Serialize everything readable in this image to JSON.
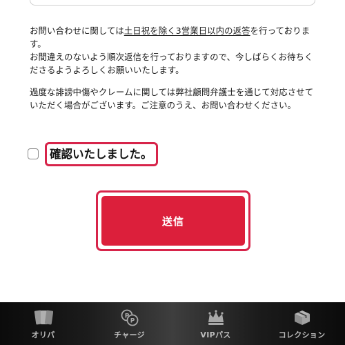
{
  "notice": {
    "para1_pre": "お問い合わせに関しては",
    "para1_underlined": "土日祝を除く3営業日以内の返答",
    "para1_post": "を行っております。",
    "para1_line2": "お間違えのないよう順次返信を行っておりますので、今しばらくお待ちくださるようよろしくお願いいたします。",
    "para2": "過度な誹謗中傷やクレームに関しては弊社顧問弁護士を通じて対応させていただく場合がございます。ご注意のうえ、お問い合わせください。"
  },
  "confirm": {
    "label": "確認いたしました。",
    "checked": false
  },
  "submit": {
    "label": "送信"
  },
  "bottom_nav": {
    "items": [
      {
        "label": "オリパ",
        "icon": "cards-icon"
      },
      {
        "label": "チャージ",
        "icon": "coins-icon"
      },
      {
        "label": "VIPパス",
        "icon": "crown-icon"
      },
      {
        "label": "コレクション",
        "icon": "box-icon"
      }
    ]
  },
  "colors": {
    "accent_red": "#dc1f3b",
    "highlight_border": "#d7244a",
    "nav_text": "#bdbdbd"
  }
}
